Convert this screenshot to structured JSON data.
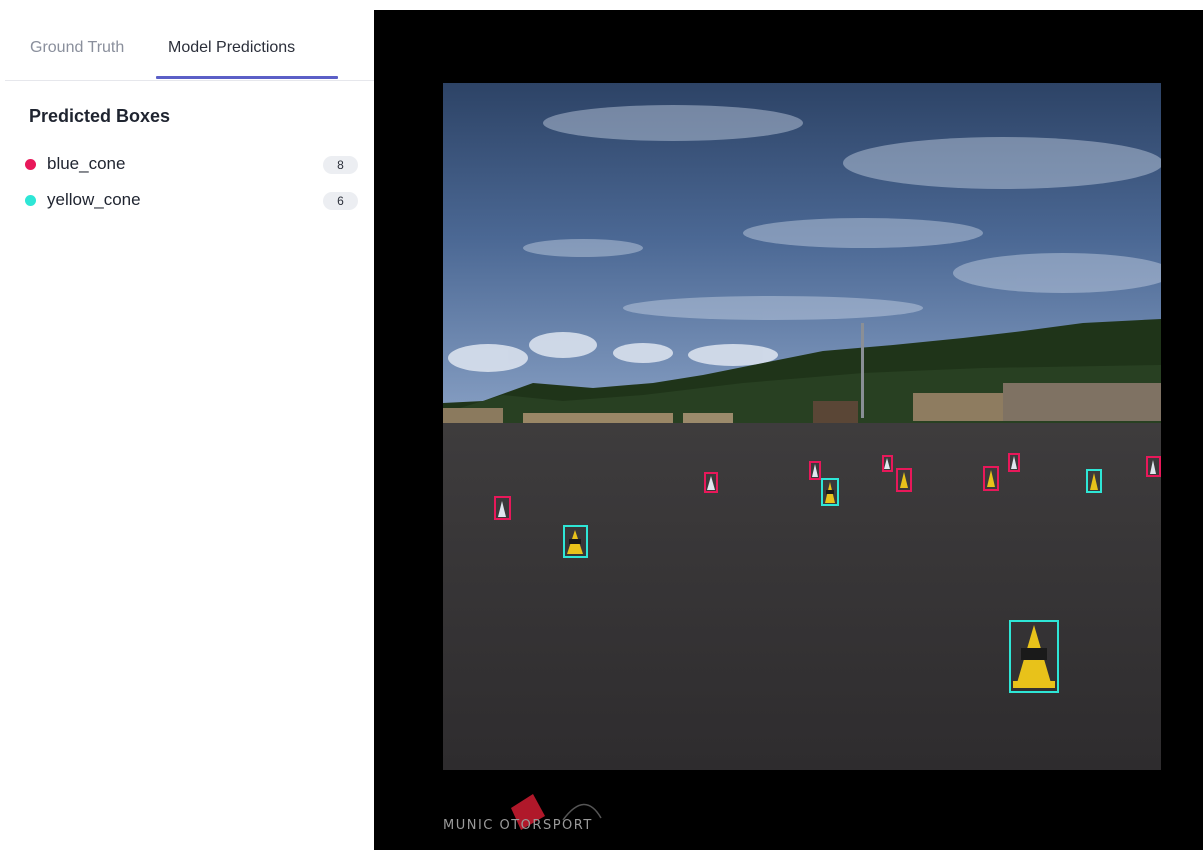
{
  "tabs": {
    "ground_truth": "Ground Truth",
    "model_predictions": "Model Predictions",
    "active": "model_predictions"
  },
  "panel": {
    "title": "Predicted Boxes",
    "labels": [
      {
        "name": "blue_cone",
        "count": "8",
        "color": "#e8185a"
      },
      {
        "name": "yellow_cone",
        "count": "6",
        "color": "#2ee6d6"
      }
    ]
  },
  "viewer": {
    "watermark": "MUNIC OTORSPORT"
  },
  "colors": {
    "accent": "#5b5fc7",
    "blue_cone_box": "#e8185a",
    "yellow_cone_box": "#2ee6d6",
    "viewer_background": "#000000"
  }
}
